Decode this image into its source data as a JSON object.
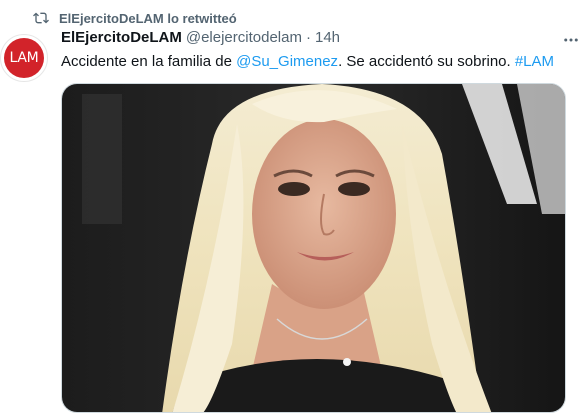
{
  "retweet": {
    "icon": "retweet-icon",
    "text": "ElEjercitoDeLAM lo retwitteó"
  },
  "tweet": {
    "avatar_text": "LAM",
    "author_name": "ElEjercitoDeLAM",
    "author_handle": "@elejercitodelam",
    "separator": "·",
    "time": "14h",
    "text_before": "Accidente en la familia de ",
    "mention": "@Su_Gimenez",
    "text_middle": ". Se accidentó su sobrino. ",
    "hashtag": "#LAM",
    "media": "photo of a blonde woman smiling in front of a dark backdrop"
  },
  "colors": {
    "accent": "#1d9bf0",
    "secondary_text": "#536471",
    "brand_red": "#d2232a"
  }
}
